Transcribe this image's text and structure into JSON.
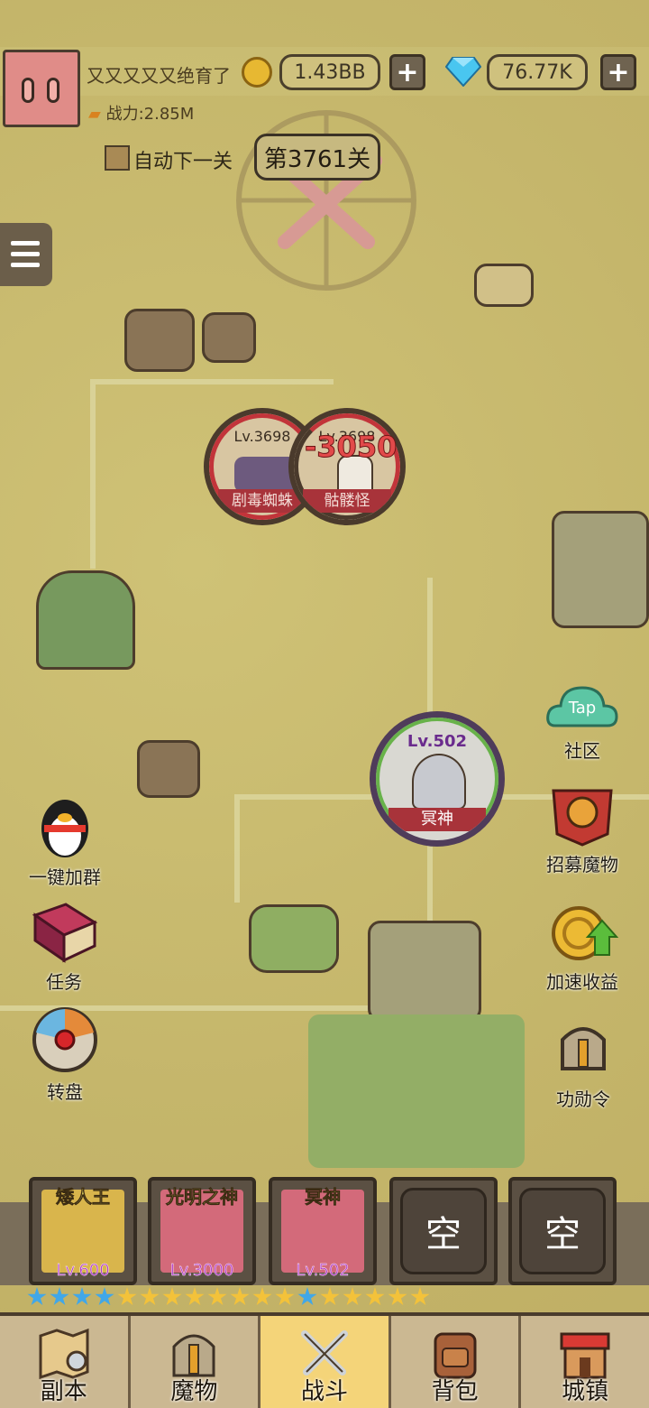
{
  "player": {
    "name": "又又又又又绝育了",
    "power": "战力:2.85M"
  },
  "currency": {
    "gold": "1.43BB",
    "gems": "76.77K"
  },
  "stage": {
    "auto_next_label": "自动下一关",
    "current": "第3761关"
  },
  "enemies": [
    {
      "level": "Lv.3698",
      "name": "剧毒蜘蛛"
    },
    {
      "level": "Lv.3698",
      "name": "骷髅怪"
    }
  ],
  "damage_popup": "-3050",
  "hero": {
    "level": "Lv.502",
    "name": "冥神",
    "hp_fraction": 0.8
  },
  "side_right": [
    {
      "label": "社区",
      "icon": "taptap-cloud-icon"
    },
    {
      "label": "招募魔物",
      "icon": "banner-helmet-icon"
    },
    {
      "label": "加速收益",
      "icon": "coin-speedup-icon"
    },
    {
      "label": "功勋令",
      "icon": "knight-helmet-icon"
    }
  ],
  "side_left": [
    {
      "label": "一键加群",
      "icon": "qq-penguin-icon"
    },
    {
      "label": "任务",
      "icon": "quest-book-icon"
    },
    {
      "label": "转盘",
      "icon": "wheel-icon"
    }
  ],
  "team_slots": [
    {
      "name": "矮人王",
      "level": "Lv.600"
    },
    {
      "name": "光明之神",
      "level": "Lv.3000"
    },
    {
      "name": "冥神",
      "level": "Lv.502"
    },
    {
      "name": "空"
    },
    {
      "name": "空"
    }
  ],
  "stars": {
    "colors": [
      "#41a7e8",
      "#41a7e8",
      "#41a7e8",
      "#41a7e8",
      "#f3c23a",
      "#f3c23a",
      "#f3c23a",
      "#f3c23a",
      "#f3c23a",
      "#f3c23a",
      "#f3c23a",
      "#f3c23a",
      "#41a7e8",
      "#f3c23a",
      "#f3c23a",
      "#f3c23a",
      "#f3c23a",
      "#f3c23a"
    ]
  },
  "nav": [
    {
      "label": "副本",
      "icon": "map-icon"
    },
    {
      "label": "魔物",
      "icon": "monster-helmet-icon"
    },
    {
      "label": "战斗",
      "icon": "crossed-swords-icon",
      "active": true
    },
    {
      "label": "背包",
      "icon": "backpack-icon"
    },
    {
      "label": "城镇",
      "icon": "shop-icon"
    }
  ]
}
